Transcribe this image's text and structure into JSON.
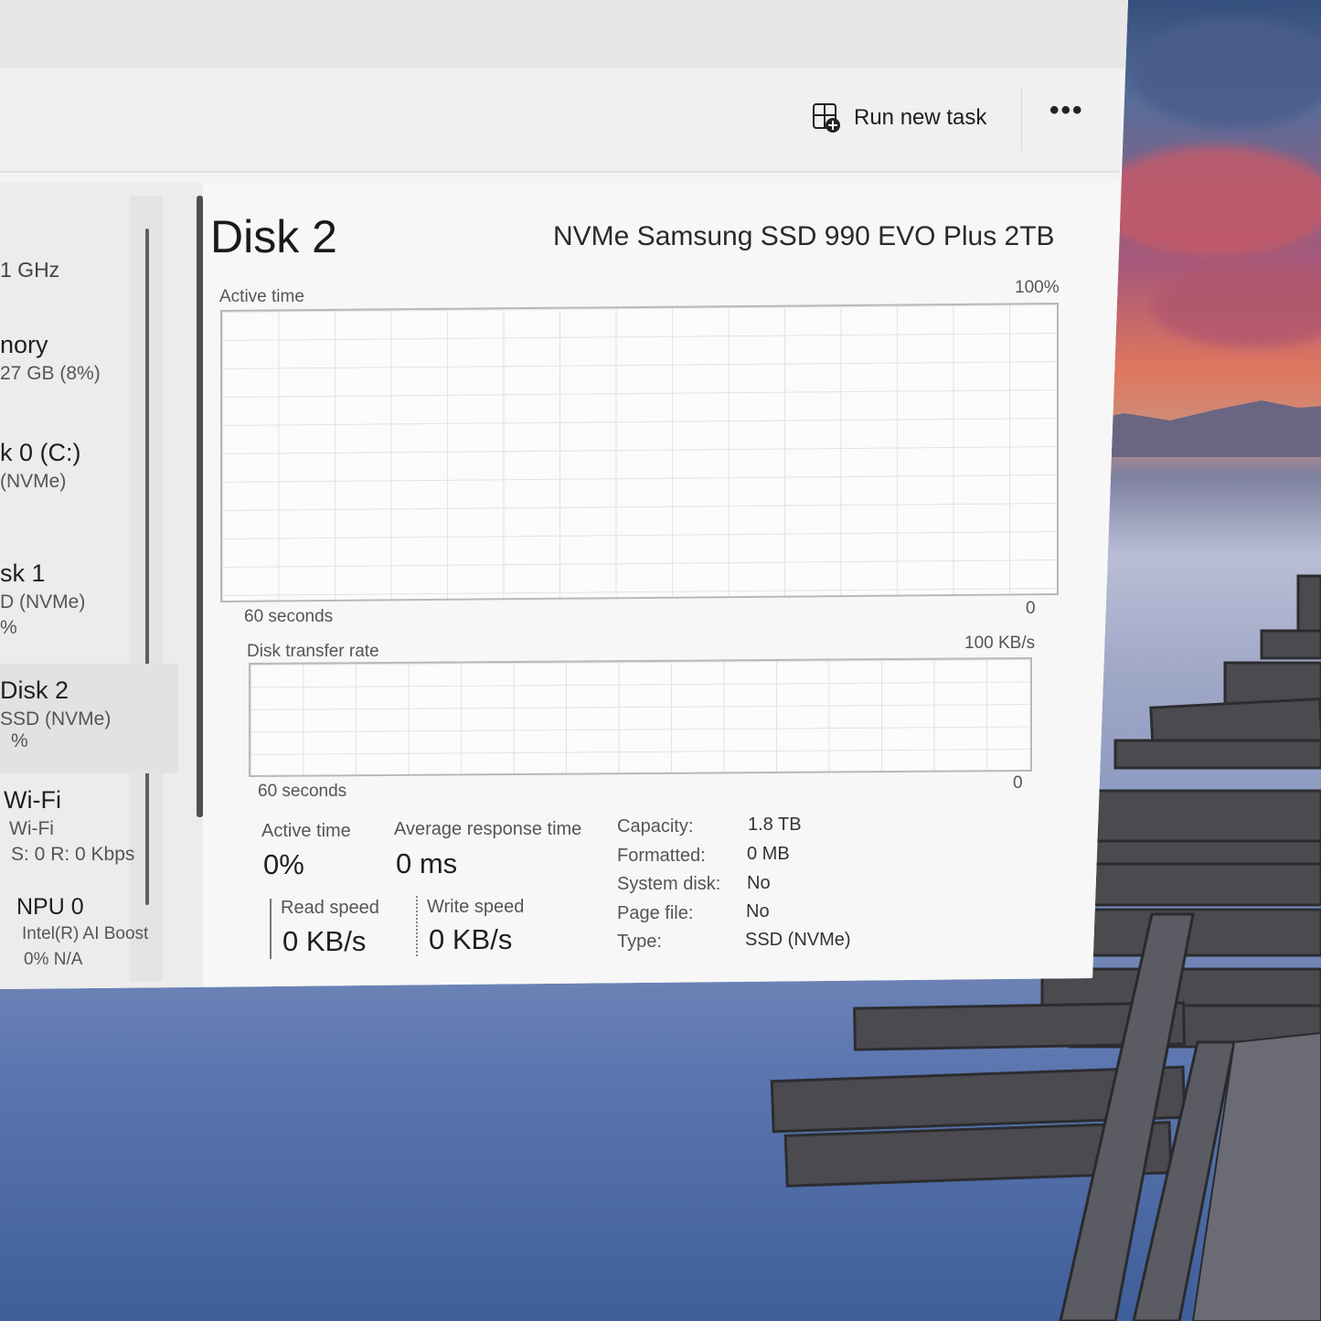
{
  "toolbar": {
    "run_new_task": "Run new task",
    "more": "•••"
  },
  "sidebar": {
    "items": [
      {
        "name": "",
        "sub": "1 GHz"
      },
      {
        "name": "nory",
        "sub": "27 GB (8%)"
      },
      {
        "name": "k 0 (C:)",
        "sub": "(NVMe)"
      },
      {
        "name": "sk 1",
        "sub": "D (NVMe)",
        "sub2": "%"
      },
      {
        "name": "Disk 2",
        "sub": "SSD (NVMe)",
        "sub2": "%"
      },
      {
        "name": "Wi-Fi",
        "sub": "Wi-Fi",
        "sub2": "S: 0 R: 0 Kbps"
      },
      {
        "name": "NPU 0",
        "sub": "Intel(R) AI Boost",
        "sub2": "0% N/A"
      }
    ]
  },
  "main": {
    "title": "Disk 2",
    "model": "NVMe Samsung SSD 990 EVO Plus 2TB",
    "graph1": {
      "label": "Active time",
      "max": "100%",
      "time": "60 seconds",
      "min": "0"
    },
    "graph2": {
      "label": "Disk transfer rate",
      "max": "100 KB/s",
      "time": "60 seconds",
      "min": "0"
    },
    "stats": {
      "active_time_label": "Active time",
      "active_time_value": "0%",
      "avg_response_label": "Average response time",
      "avg_response_value": "0 ms",
      "read_speed_label": "Read speed",
      "read_speed_value": "0 KB/s",
      "write_speed_label": "Write speed",
      "write_speed_value": "0 KB/s"
    },
    "properties": [
      {
        "label": "Capacity:",
        "value": "1.8 TB"
      },
      {
        "label": "Formatted:",
        "value": "0 MB"
      },
      {
        "label": "System disk:",
        "value": "No"
      },
      {
        "label": "Page file:",
        "value": "No"
      },
      {
        "label": "Type:",
        "value": "SSD (NVMe)"
      }
    ]
  },
  "colors": {
    "window_bg": "#f3f3f3",
    "graph_border": "#b8b8b8",
    "text": "#1f1f1f"
  },
  "icons": {
    "run_task": "run-task-icon",
    "more": "more-options-icon"
  }
}
